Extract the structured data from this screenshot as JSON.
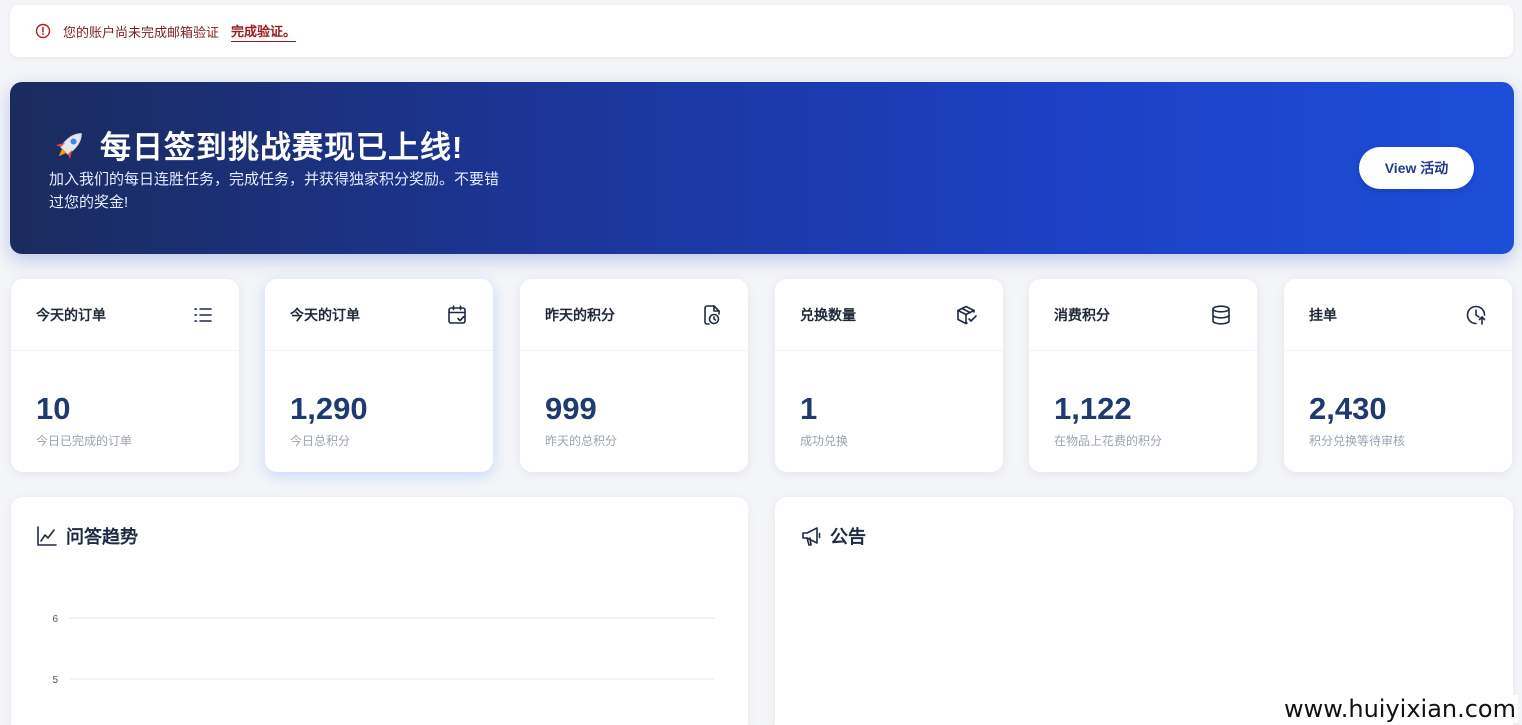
{
  "alert": {
    "message": "您的账户尚未完成邮箱验证",
    "link_label": "完成验证。"
  },
  "banner": {
    "title": "每日签到挑战赛现已上线!",
    "description": "加入我们的每日连胜任务，完成任务，并获得独家积分奖励。不要错过您的奖金!",
    "cta_label": "View 活动"
  },
  "stats": [
    {
      "label": "今天的订单",
      "icon": "list-icon",
      "value": "10",
      "sub": "今日已完成的订单"
    },
    {
      "label": "今天的订单",
      "icon": "calendar-check-icon",
      "value": "1,290",
      "sub": "今日总积分"
    },
    {
      "label": "昨天的积分",
      "icon": "document-clock-icon",
      "value": "999",
      "sub": "昨天的总积分"
    },
    {
      "label": "兑换数量",
      "icon": "box-check-icon",
      "value": "1",
      "sub": "成功兑换"
    },
    {
      "label": "消费积分",
      "icon": "database-icon",
      "value": "1,122",
      "sub": "在物品上花费的积分"
    },
    {
      "label": "挂单",
      "icon": "clock-arrow-icon",
      "value": "2,430",
      "sub": "积分兑换等待审核"
    }
  ],
  "trend_panel": {
    "title": "问答趋势",
    "icon": "line-chart-icon"
  },
  "notice_panel": {
    "title": "公告",
    "icon": "megaphone-icon"
  },
  "chart_data": {
    "type": "line",
    "title": "",
    "xlabel": "",
    "ylabel": "",
    "y_ticks": [
      "6",
      "5"
    ],
    "series": []
  },
  "watermark": "www.huiyixian.com",
  "colors": {
    "accent": "#1d4ed8",
    "banner_start": "#1b2b5e",
    "value_text": "#1e3a6e",
    "alert_text": "#7f1d1d"
  }
}
